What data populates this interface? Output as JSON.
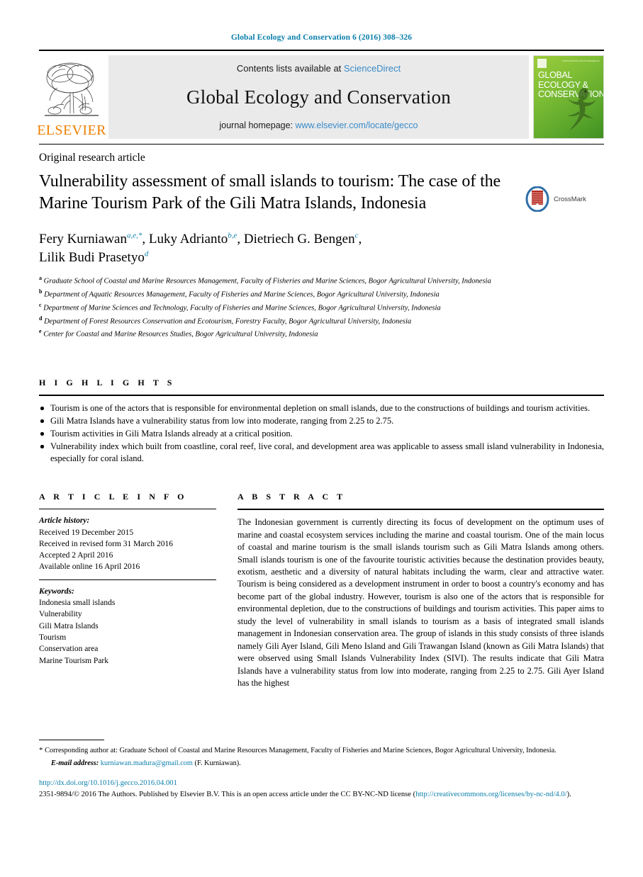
{
  "running_head": "Global Ecology and Conservation 6 (2016) 308–326",
  "banner": {
    "publisher_logo_text": "ELSEVIER",
    "contents_prefix": "Contents lists available at",
    "contents_link": "ScienceDirect",
    "journal_title": "Global Ecology and Conservation",
    "homepage_prefix": "journal homepage:",
    "homepage_link": "www.elsevier.com/locate/gecco",
    "cover_title_line1": "GLOBAL",
    "cover_title_line2": "ECOLOGY &",
    "cover_title_line3": "CONSERVATION",
    "cover_tagline": "www.elsevier.com/locate/gecco"
  },
  "article": {
    "type": "Original research article",
    "title": "Vulnerability assessment of small islands to tourism: The case of the Marine Tourism Park of the Gili Matra Islands, Indonesia",
    "crossmark_label": "CrossMark"
  },
  "authors": {
    "line1_name1": "Fery Kurniawan",
    "line1_sup1": "a,e,*",
    "line1_sep1": ", ",
    "line1_name2": "Luky Adrianto",
    "line1_sup2": "b,e",
    "line1_sep2": ", ",
    "line1_name3": "Dietriech G. Bengen",
    "line1_sup3": "c",
    "line1_sep3": ",",
    "line2_name4": "Lilik Budi Prasetyo",
    "line2_sup4": "d"
  },
  "affiliations": [
    {
      "marker": "a",
      "text": "Graduate School of Coastal and Marine Resources Management, Faculty of Fisheries and Marine Sciences, Bogor Agricultural University, Indonesia"
    },
    {
      "marker": "b",
      "text": "Department of Aquatic Resources Management, Faculty of Fisheries and Marine Sciences, Bogor Agricultural University, Indonesia"
    },
    {
      "marker": "c",
      "text": "Department of Marine Sciences and Technology, Faculty of Fisheries and Marine Sciences, Bogor Agricultural University, Indonesia"
    },
    {
      "marker": "d",
      "text": "Department of Forest Resources Conservation and Ecotourism, Forestry Faculty, Bogor Agricultural University, Indonesia"
    },
    {
      "marker": "e",
      "text": "Center for Coastal and Marine Resources Studies, Bogor Agricultural University, Indonesia"
    }
  ],
  "highlights": {
    "heading": "H I G H L I G H T S",
    "items": [
      "Tourism is one of the actors that is responsible for environmental depletion on small islands, due to the constructions of buildings and tourism activities.",
      "Gili Matra Islands have a vulnerability status from low into moderate, ranging from 2.25 to 2.75.",
      "Tourism activities in Gili Matra Islands already at a critical position.",
      "Vulnerability index which built from coastline, coral reef, live coral, and development area was applicable to assess small island vulnerability in Indonesia, especially for coral island."
    ]
  },
  "article_info": {
    "heading": "A R T I C L E     I N F O",
    "history_label": "Article history:",
    "history": [
      "Received 19 December 2015",
      "Received in revised form 31 March 2016",
      "Accepted 2 April 2016",
      "Available online 16 April 2016"
    ],
    "keywords_label": "Keywords:",
    "keywords": [
      "Indonesia small islands",
      "Vulnerability",
      "Gili Matra Islands",
      "Tourism",
      "Conservation area",
      "Marine Tourism Park"
    ]
  },
  "abstract": {
    "heading": "A B S T R A C T",
    "text": "The Indonesian government is currently directing its focus of development on the optimum uses of marine and coastal ecosystem services including the marine and coastal tourism. One of the main locus of coastal and marine tourism is the small islands tourism such as Gili Matra Islands among others. Small islands tourism is one of the favourite touristic activities because the destination provides beauty, exotism, aesthetic and a diversity of natural habitats including the warm, clear and attractive water. Tourism is being considered as a development instrument in order to boost a country's economy and has become part of the global industry. However, tourism is also one of the actors that is responsible for environmental depletion, due to the constructions of buildings and tourism activities. This paper aims to study the level of vulnerability in small islands to tourism as a basis of integrated small islands management in Indonesian conservation area. The group of islands in this study consists of three islands namely Gili Ayer Island, Gili Meno Island and Gili Trawangan Island (known as Gili Matra Islands) that were observed using Small Islands Vulnerability Index (SIVI). The results indicate that Gili Matra Islands have a vulnerability status from low into moderate, ranging from 2.25 to 2.75. Gili Ayer Island has the highest"
  },
  "footnotes": {
    "corresponding_star": "*",
    "corresponding_text": "Corresponding author at: Graduate School of Coastal and Marine Resources Management, Faculty of Fisheries and Marine Sciences, Bogor Agricultural University, Indonesia.",
    "email_label": "E-mail address:",
    "email": "kurniawan.madura@gmail.com",
    "email_owner": "(F. Kurniawan).",
    "doi": "http://dx.doi.org/10.1016/j.gecco.2016.04.001",
    "copyright_prefix": "2351-9894/© 2016 The Authors. Published by Elsevier B.V. This is an open access article under the CC BY-NC-ND license (",
    "license_url": "http://creativecommons.org/licenses/by-nc-nd/4.0/",
    "copyright_suffix": ")."
  },
  "colors": {
    "link": "#0b7fab",
    "elsevier_orange": "#EE7F00",
    "banner_bg": "#eaeaea",
    "sciencedirect_blue": "#3a8bc8"
  }
}
